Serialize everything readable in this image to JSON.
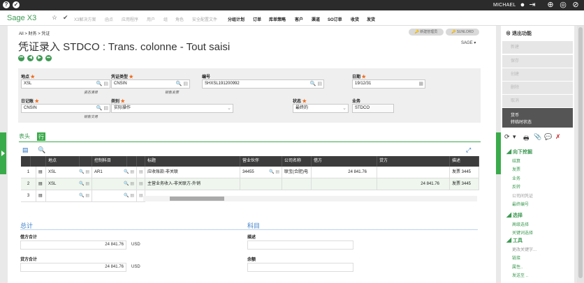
{
  "topbar": {
    "user": "MICHAEL"
  },
  "menubar": {
    "brand": "Sage X3",
    "items": [
      "X3解决方案",
      "函点",
      "应用程序",
      "用户",
      "组",
      "角色",
      "安全配置文件",
      "分组计划",
      "订单",
      "库单策略",
      "客户",
      "渠道",
      "SO订单",
      "收货",
      "发货"
    ]
  },
  "page": {
    "breadcrumb": [
      "All",
      "财务",
      "凭证"
    ],
    "title": "凭证录入 STDCO : Trans. colonne - Tout saisi",
    "folder": "SAGE",
    "pills": [
      "新建管理员",
      "SUNLORD"
    ]
  },
  "header": {
    "site_label": "地点",
    "site_value": "XSL",
    "site_hint": "姿态清单",
    "doctype_label": "凭证类型",
    "doctype_value": "CNSIN",
    "doctype_hint": "销售发票",
    "number_label": "编号",
    "number_value": "SHXSL191200992",
    "date_label": "日期",
    "date_value": "19/12/31",
    "journal_label": "日记账",
    "journal_value": "CNSIN",
    "journal_hint": "销售交易",
    "category_label": "类别",
    "category_value": "实际操作",
    "status_label": "状态",
    "status_value": "最终的",
    "txn_label": "业务",
    "txn_value": "STDCO"
  },
  "tabs": {
    "header_tab": "表头",
    "line_tab": "行"
  },
  "grid": {
    "columns": [
      "",
      "",
      "地点",
      "",
      "控制科目",
      "",
      "",
      "标题",
      "营业伙伴",
      "公司名称",
      "借方",
      "贷方",
      "描述"
    ],
    "rows": [
      {
        "num": "1",
        "site": "XSL",
        "ctrl": "AR1",
        "title": "应收账款-非关联",
        "bp": "34455",
        "company": "联宝(合肥)电",
        "debit": "24 841.76",
        "credit": "",
        "desc": "发票 3445"
      },
      {
        "num": "2",
        "site": "XSL",
        "ctrl": "",
        "title": "主营业务收入-非关联方-外销",
        "bp": "",
        "company": "",
        "debit": "",
        "credit": "24 841.76",
        "desc": "发票 3445"
      },
      {
        "num": "3",
        "site": "",
        "ctrl": "",
        "title": "",
        "bp": "",
        "company": "",
        "debit": "",
        "credit": "",
        "desc": ""
      }
    ]
  },
  "totals": {
    "section": "总计",
    "debit_label": "借方合计",
    "debit_value": "24 841.76",
    "debit_cur": "USD",
    "credit_label": "贷方合计",
    "credit_value": "24 841.76",
    "credit_cur": "USD"
  },
  "account": {
    "section": "科目",
    "desc_label": "描述",
    "balance_label": "余额"
  },
  "right": {
    "exit": "退出功能",
    "actions": [
      "新建",
      "保存",
      "创建",
      "删除",
      "取消"
    ],
    "active1": "货币",
    "active2": "转临时状态",
    "sec1": "向下挖掘",
    "links1": [
      "结算",
      "发票",
      "业务",
      "反转",
      "公司间凭证",
      "最终编号"
    ],
    "sec2": "选择",
    "links2": [
      "高级选择",
      "关键词选择"
    ],
    "sec3": "工具",
    "links3": [
      "更改关键字...",
      "链接",
      "属性..",
      "发送至 .."
    ]
  }
}
